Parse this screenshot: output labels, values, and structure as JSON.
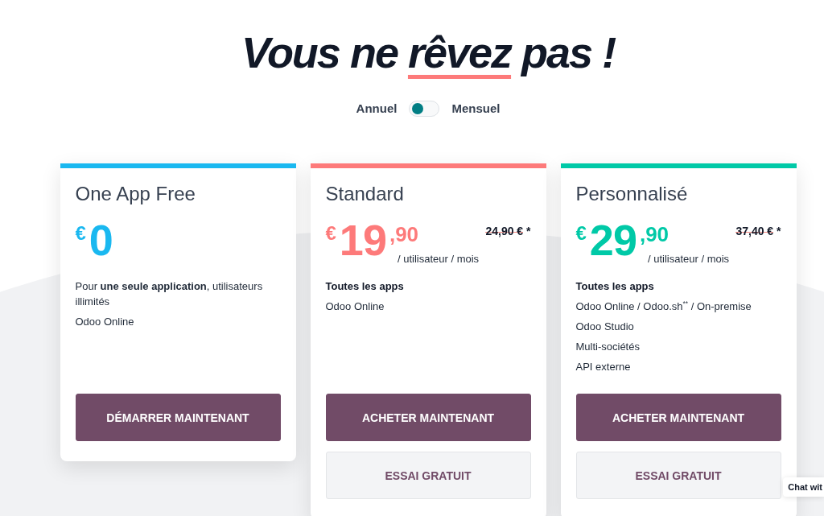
{
  "title": {
    "segments": [
      {
        "text": "Vous ne",
        "underlined": false
      },
      {
        "text": "rêvez",
        "underlined": true
      },
      {
        "text": "pas !",
        "underlined": false
      }
    ]
  },
  "billing_toggle": {
    "left_label": "Annuel",
    "right_label": "Mensuel",
    "on": false
  },
  "plans": [
    {
      "name": "One App Free",
      "color": "#1ab8f0",
      "price": {
        "currency": "€",
        "whole": "0"
      },
      "features": [
        {
          "kind": "item",
          "text": "Pour **une seule application**, utilisateurs illimités"
        },
        {
          "kind": "item",
          "text": "Odoo Online"
        }
      ],
      "buttons": [
        {
          "kind": "primary",
          "label": "DÉMARRER MAINTENANT"
        }
      ]
    },
    {
      "name": "Standard",
      "color": "#fd7a7a",
      "price": {
        "currency": "€",
        "whole": "19",
        "decimals": ",90"
      },
      "old_price": "24,90 €",
      "old_price_note": "*",
      "period": "/ utilisateur / mois",
      "features": [
        {
          "kind": "heading",
          "text": "Toutes les apps"
        },
        {
          "kind": "item",
          "text": "Odoo Online"
        }
      ],
      "buttons": [
        {
          "kind": "primary",
          "label": "ACHETER MAINTENANT"
        },
        {
          "kind": "secondary",
          "label": "ESSAI GRATUIT"
        }
      ]
    },
    {
      "name": "Personnalisé",
      "color": "#00c9a7",
      "price": {
        "currency": "€",
        "whole": "29",
        "decimals": ",90"
      },
      "old_price": "37,40 €",
      "old_price_note": "*",
      "period": "/ utilisateur / mois",
      "features": [
        {
          "kind": "heading",
          "text": "Toutes les apps"
        },
        {
          "kind": "item",
          "text": "Odoo Online / Odoo.sh$^{**}$ / On-premise"
        },
        {
          "kind": "item",
          "text": "Odoo Studio"
        },
        {
          "kind": "item",
          "text": "Multi-sociétés"
        },
        {
          "kind": "item",
          "text": "API externe"
        }
      ],
      "buttons": [
        {
          "kind": "primary",
          "label": "ACHETER MAINTENANT"
        },
        {
          "kind": "secondary",
          "label": "ESSAI GRATUIT"
        }
      ]
    }
  ],
  "chat_button": {
    "label": "Chat wit"
  }
}
